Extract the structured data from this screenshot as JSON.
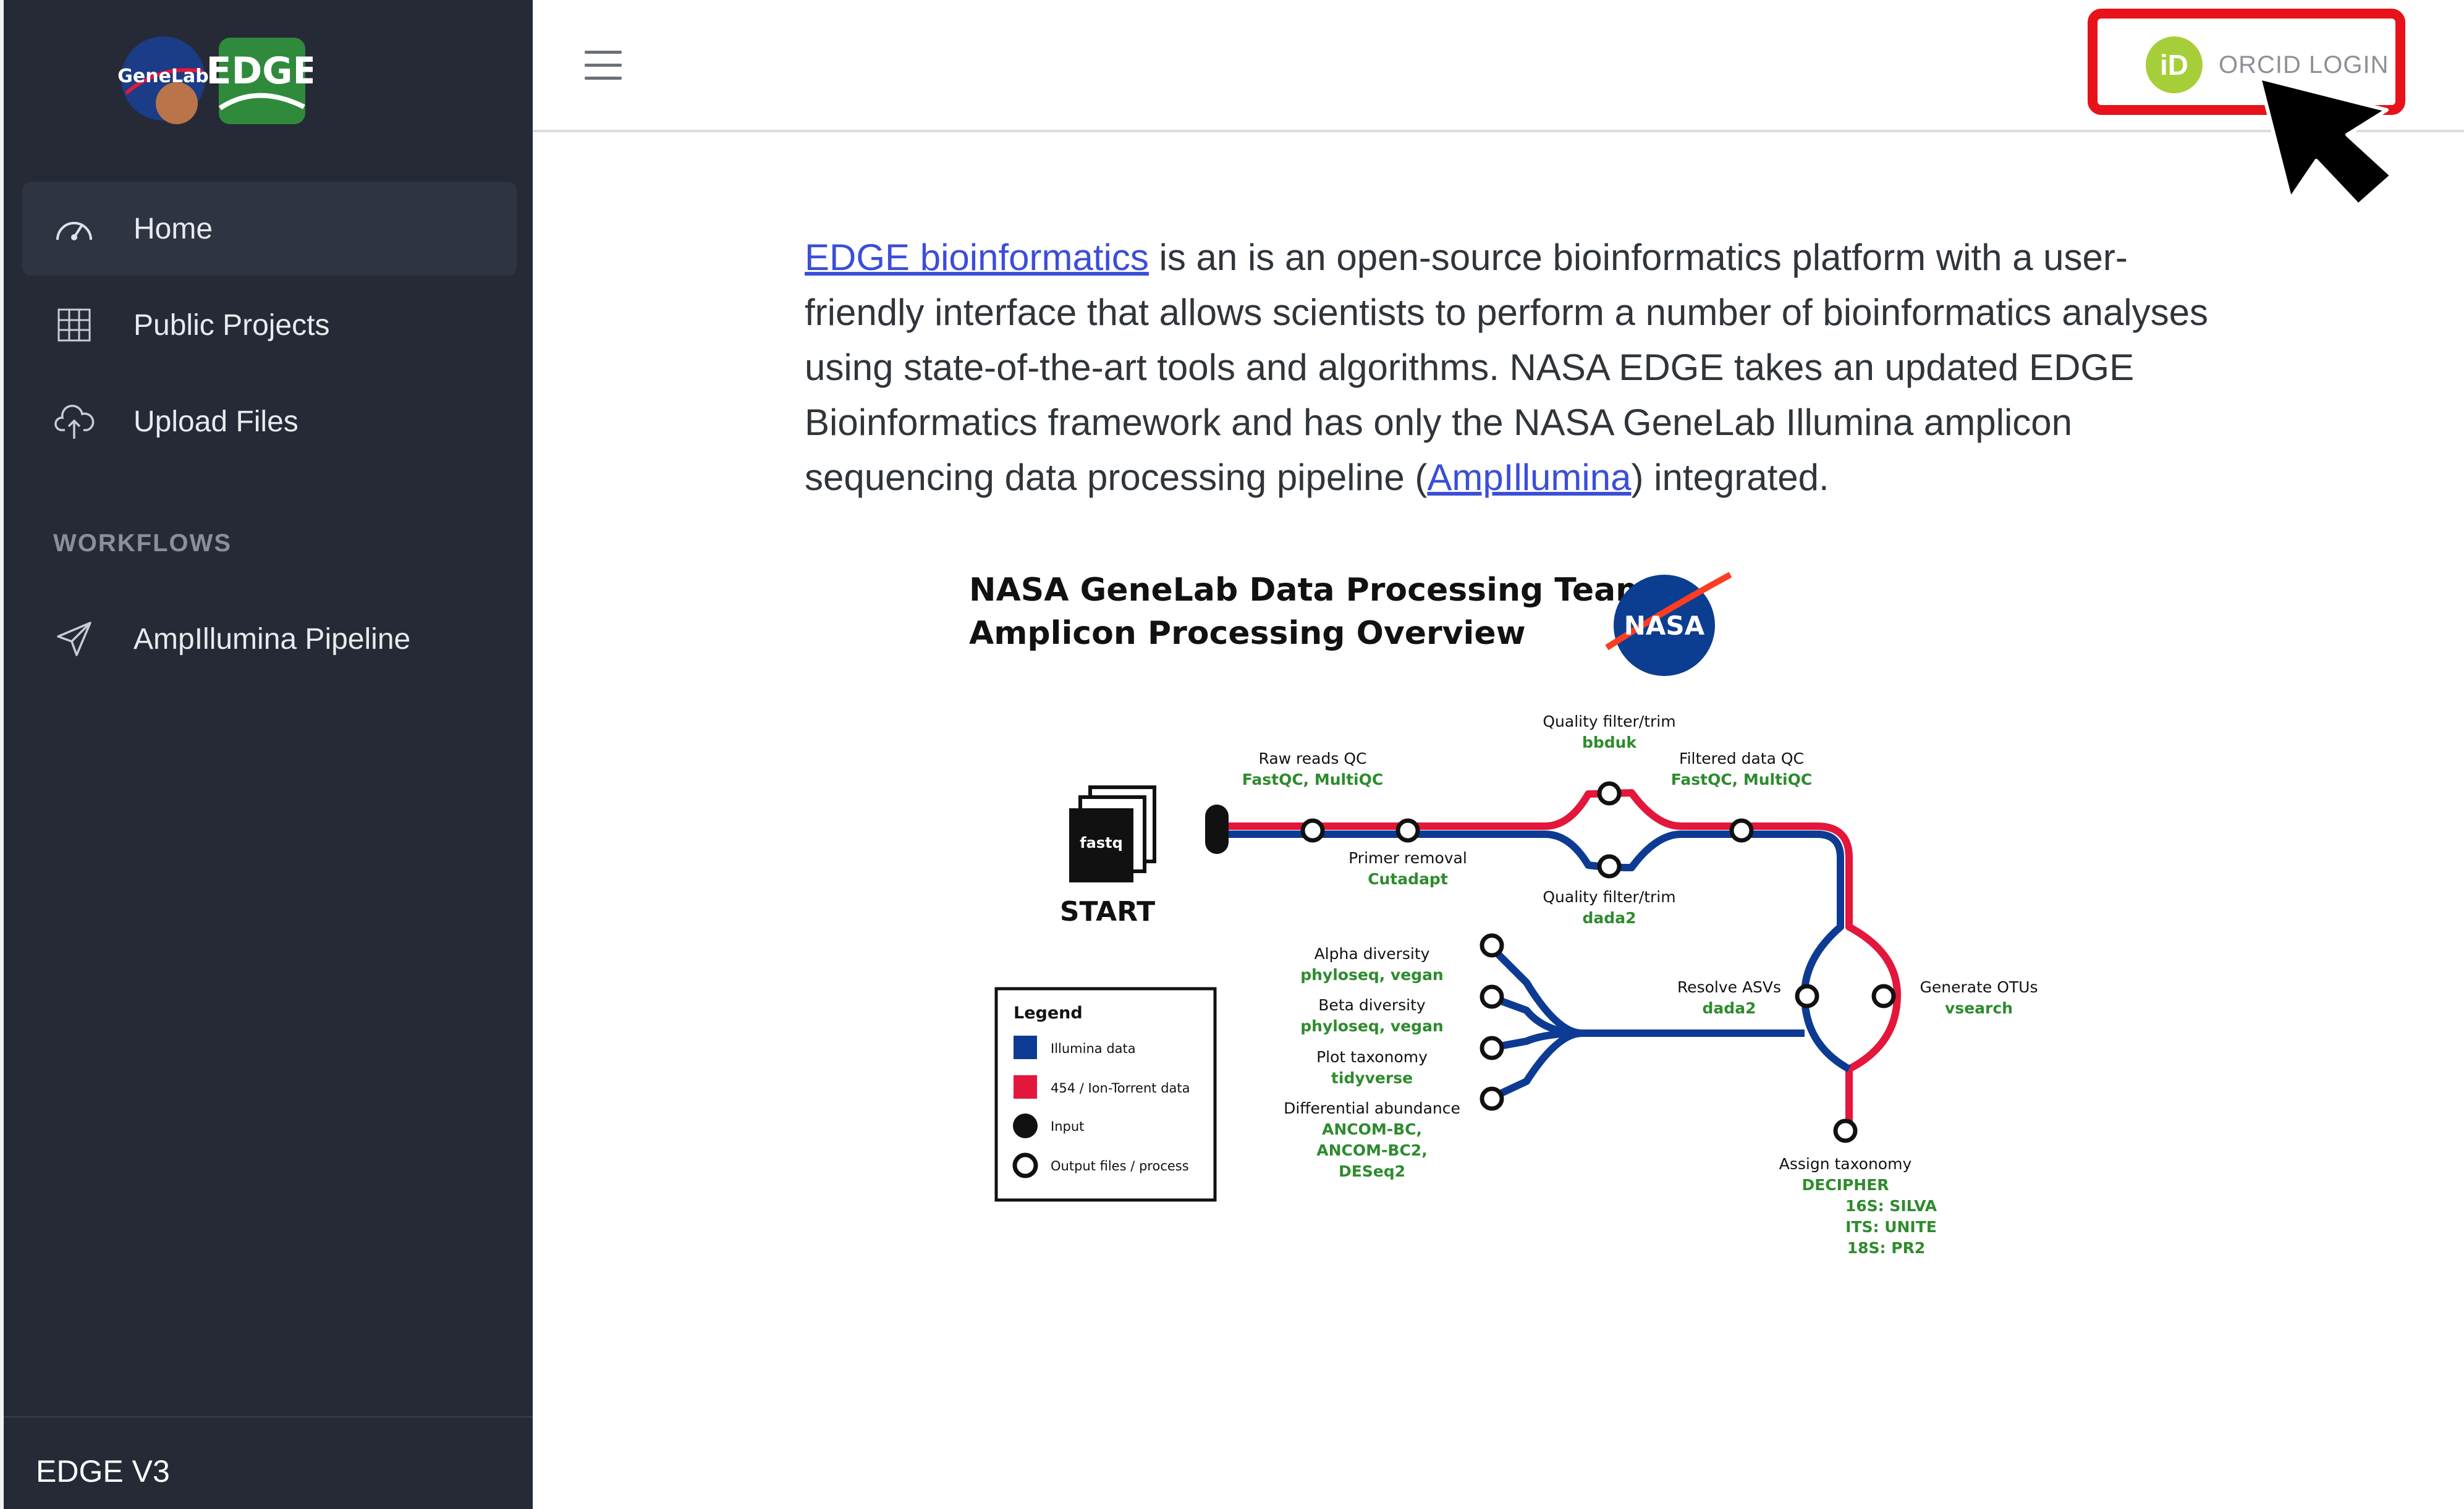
{
  "brand": {
    "genelab_logo_text": "GeneLab",
    "edge_logo_text": "EDGE"
  },
  "sidebar": {
    "items": [
      {
        "label": "Home",
        "icon": "speedometer-icon",
        "active": true
      },
      {
        "label": "Public Projects",
        "icon": "grid-icon",
        "active": false
      },
      {
        "label": "Upload Files",
        "icon": "cloud-upload-icon",
        "active": false
      }
    ],
    "workflows_heading": "WORKFLOWS",
    "workflows": [
      {
        "label": "AmpIllumina Pipeline",
        "icon": "paper-plane-icon"
      }
    ],
    "footer_version": "EDGE V3"
  },
  "header": {
    "menu_icon": "hamburger-icon",
    "orcid_icon_text": "iD",
    "orcid_label": "ORCID LOGIN"
  },
  "intro": {
    "link1": "EDGE bioinformatics",
    "text1": " is an is an open-source bioinformatics platform with a user-friendly interface that allows scientists to perform a number of bioinformatics analyses using state-of-the-art tools and algorithms. NASA EDGE takes an updated EDGE Bioinformatics framework and has only the NASA GeneLab Illumina amplicon sequencing data processing pipeline (",
    "link2": "AmpIllumina",
    "text2": ") integrated."
  },
  "diagram": {
    "title_line1": "NASA GeneLab Data Processing Team",
    "title_line2": "Amplicon Processing Overview",
    "nasa_logo_text": "NASA",
    "file_label": "fastq",
    "start_label": "START",
    "colors": {
      "illumina": "#0d3b94",
      "ion_torrent": "#e3173b",
      "tool_green": "#2e8b2e"
    },
    "steps": {
      "raw_qc": {
        "name": "Raw reads QC",
        "tool": "FastQC, MultiQC"
      },
      "primer": {
        "name": "Primer removal",
        "tool": "Cutadapt"
      },
      "qf_top": {
        "name": "Quality filter/trim",
        "tool": "bbduk"
      },
      "qf_bottom": {
        "name": "Quality filter/trim",
        "tool": "dada2"
      },
      "filtered_qc": {
        "name": "Filtered data QC",
        "tool": "FastQC, MultiQC"
      },
      "resolve": {
        "name": "Resolve ASVs",
        "tool": "dada2"
      },
      "otus": {
        "name": "Generate OTUs",
        "tool": "vsearch"
      },
      "taxonomy": {
        "name": "Assign taxonomy",
        "tool": "DECIPHER",
        "db1": "16S: SILVA",
        "db2": "ITS: UNITE",
        "db3": "18S: PR2"
      },
      "alpha": {
        "name": "Alpha diversity",
        "tool": "phyloseq, vegan"
      },
      "beta": {
        "name": "Beta diversity",
        "tool": "phyloseq, vegan"
      },
      "plot_tax": {
        "name": "Plot taxonomy",
        "tool": "tidyverse"
      },
      "diff": {
        "name": "Differential abundance",
        "tool1": "ANCOM-BC,",
        "tool2": "ANCOM-BC2,",
        "tool3": "DESeq2"
      }
    },
    "legend": {
      "title": "Legend",
      "illumina": "Illumina data",
      "ion": "454 / Ion-Torrent data",
      "input": "Input",
      "output": "Output files / process"
    }
  }
}
